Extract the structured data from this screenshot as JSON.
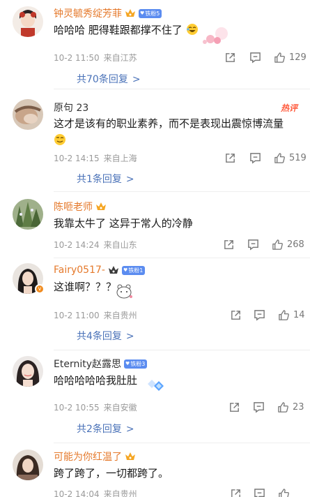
{
  "comments": [
    {
      "name": "钟灵毓秀绽芳菲",
      "fan_badge": "铁粉5",
      "text": "哈哈哈 肥得鞋跟都撑不住了",
      "date": "10-2 11:50",
      "location": "来自江苏",
      "likes": "129",
      "replies": "共70条回复",
      "chevron": ">"
    },
    {
      "name": "原句 23",
      "hot_badge": "热评",
      "text": "这才是该有的职业素养，而不是表现出震惊博流量",
      "date": "10-2 14:15",
      "location": "来自上海",
      "likes": "519",
      "replies": "共1条回复",
      "chevron": ">"
    },
    {
      "name": "陈咂老师",
      "text": "我靠太牛了 这异于常人的冷静",
      "date": "10-2 14:24",
      "location": "来自山东",
      "likes": "268"
    },
    {
      "name": "Fairy0517-",
      "fan_badge": "铁粉1",
      "text": "这谁啊？？？",
      "date": "10-2 11:00",
      "location": "来自贵州",
      "likes": "14",
      "replies": "共4条回复",
      "chevron": ">"
    },
    {
      "name": "Eternity赵露思",
      "fan_badge": "铁粉3",
      "text": "哈哈哈哈哈我肚肚",
      "date": "10-2 10:55",
      "location": "来自安徽",
      "likes": "23",
      "replies": "共2条回复",
      "chevron": ">"
    },
    {
      "name": "可能为你红温了",
      "text": "跨了跨了，一切都跨了。",
      "date": "10-2 14:04",
      "location": "来自贵州"
    }
  ],
  "colors": {
    "name_orange": "#e5792b",
    "link_blue": "#4a72b8",
    "fan_badge_blue": "#5b8cf0",
    "hot_red": "#ff5a3c",
    "meta_gray": "#9a9a9a"
  },
  "icons": [
    "share-icon",
    "comment-icon",
    "like-icon",
    "crown-icon",
    "laugh-emoji-icon",
    "wink-emoji-icon"
  ]
}
